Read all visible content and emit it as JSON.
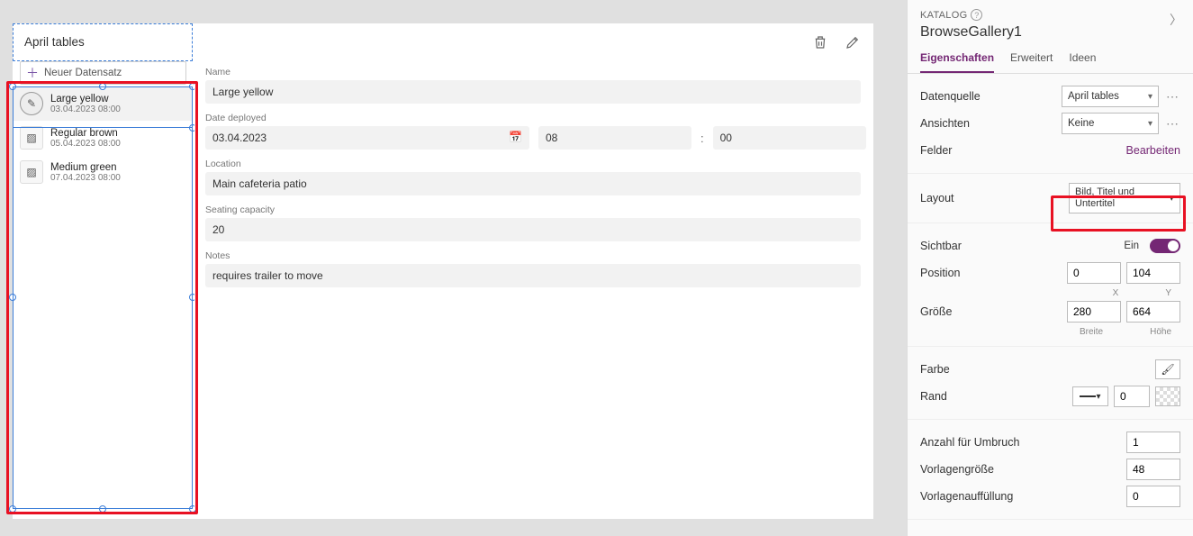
{
  "gallery": {
    "title": "April tables",
    "new_label": "Neuer Datensatz",
    "items": [
      {
        "title": "Large yellow",
        "sub": "03.04.2023 08:00",
        "selected": true
      },
      {
        "title": "Regular brown",
        "sub": "05.04.2023 08:00",
        "selected": false
      },
      {
        "title": "Medium green",
        "sub": "07.04.2023 08:00",
        "selected": false
      }
    ]
  },
  "form": {
    "labels": {
      "name": "Name",
      "date": "Date deployed",
      "location": "Location",
      "seating": "Seating capacity",
      "notes": "Notes"
    },
    "values": {
      "name": "Large yellow",
      "date": "03.04.2023",
      "hour": "08",
      "minute": "00",
      "location": "Main cafeteria patio",
      "seating": "20",
      "notes": "requires trailer to move"
    }
  },
  "props": {
    "catalog": "KATALOG",
    "name": "BrowseGallery1",
    "tabs": {
      "eigenschaften": "Eigenschaften",
      "erweitert": "Erweitert",
      "ideen": "Ideen"
    },
    "labels": {
      "datenquelle": "Datenquelle",
      "ansichten": "Ansichten",
      "felder": "Felder",
      "bearbeiten": "Bearbeiten",
      "layout": "Layout",
      "sichtbar": "Sichtbar",
      "ein": "Ein",
      "position": "Position",
      "x": "X",
      "y": "Y",
      "groesse": "Größe",
      "breite": "Breite",
      "hoehe": "Höhe",
      "farbe": "Farbe",
      "rand": "Rand",
      "umbruch": "Anzahl für Umbruch",
      "vorlagengroesse": "Vorlagengröße",
      "vorlagenauffuellung": "Vorlagenauffüllung"
    },
    "values": {
      "datenquelle": "April tables",
      "ansichten": "Keine",
      "layout": "Bild, Titel und Untertitel",
      "pos_x": "0",
      "pos_y": "104",
      "size_w": "280",
      "size_h": "664",
      "rand": "0",
      "umbruch": "1",
      "vorlagengroesse": "48",
      "vorlagenauffuellung": "0"
    }
  }
}
